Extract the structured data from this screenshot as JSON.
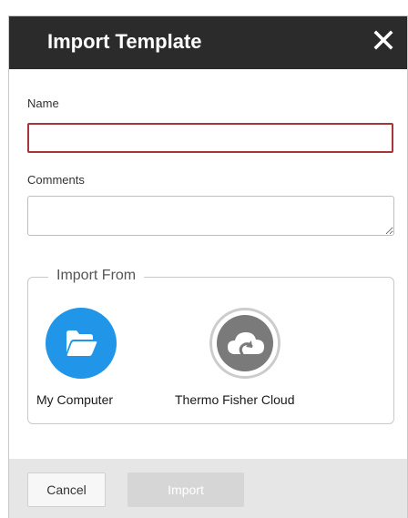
{
  "dialog": {
    "title": "Import Template",
    "close_icon": "close-icon"
  },
  "form": {
    "name_label": "Name",
    "name_value": "",
    "comments_label": "Comments",
    "comments_value": ""
  },
  "import_from": {
    "legend": "Import From",
    "sources": [
      {
        "label": "My Computer",
        "icon": "folder-icon",
        "color": "#2196e8"
      },
      {
        "label": "Thermo Fisher Cloud",
        "icon": "cloud-upload-icon",
        "color": "#7a7a7a"
      }
    ]
  },
  "footer": {
    "cancel_label": "Cancel",
    "import_label": "Import"
  },
  "colors": {
    "header_bg": "#2b2b2b",
    "invalid_border": "#a8353a",
    "accent": "#2196e8",
    "disabled_button": "#d6d6d6"
  }
}
